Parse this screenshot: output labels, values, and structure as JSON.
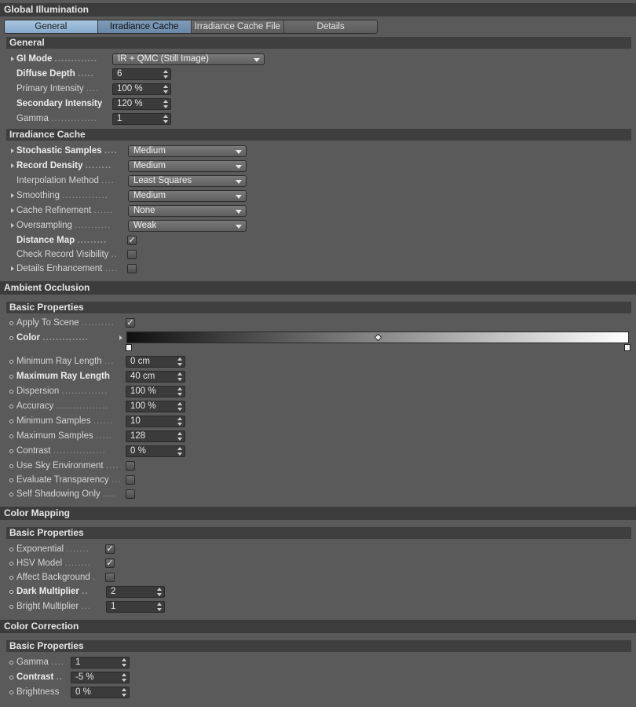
{
  "window_title": "Global Illumination",
  "tabs": [
    {
      "label": "General"
    },
    {
      "label": "Irradiance Cache"
    },
    {
      "label": "Irradiance Cache File"
    },
    {
      "label": "Details"
    }
  ],
  "general": {
    "title": "General",
    "gi_mode": {
      "label": "GI Mode",
      "value": "IR + QMC (Still Image)"
    },
    "diffuse_depth": {
      "label": "Diffuse Depth",
      "value": "6"
    },
    "primary_intensity": {
      "label": "Primary Intensity",
      "value": "100 %"
    },
    "secondary_intensity": {
      "label": "Secondary Intensity",
      "value": "120 %"
    },
    "gamma": {
      "label": "Gamma",
      "value": "1"
    }
  },
  "irradiance_cache": {
    "title": "Irradiance Cache",
    "stochastic_samples": {
      "label": "Stochastic Samples",
      "value": "Medium"
    },
    "record_density": {
      "label": "Record Density",
      "value": "Medium"
    },
    "interpolation_method": {
      "label": "Interpolation Method",
      "value": "Least Squares"
    },
    "smoothing": {
      "label": "Smoothing",
      "value": "Medium"
    },
    "cache_refinement": {
      "label": "Cache Refinement",
      "value": "None"
    },
    "oversampling": {
      "label": "Oversampling",
      "value": "Weak"
    },
    "distance_map": {
      "label": "Distance Map",
      "checked": true
    },
    "check_record_visibility": {
      "label": "Check Record Visibility",
      "checked": false
    },
    "details_enhancement": {
      "label": "Details Enhancement",
      "checked": false
    }
  },
  "ambient_occlusion": {
    "title": "Ambient Occlusion",
    "sub_title": "Basic Properties",
    "apply_to_scene": {
      "label": "Apply To Scene",
      "checked": true
    },
    "color": {
      "label": "Color"
    },
    "min_ray_length": {
      "label": "Minimum Ray Length",
      "value": "0 cm"
    },
    "max_ray_length": {
      "label": "Maximum Ray Length",
      "value": "40 cm"
    },
    "dispersion": {
      "label": "Dispersion",
      "value": "100 %"
    },
    "accuracy": {
      "label": "Accuracy",
      "value": "100 %"
    },
    "min_samples": {
      "label": "Minimum Samples",
      "value": "10"
    },
    "max_samples": {
      "label": "Maximum Samples",
      "value": "128"
    },
    "contrast": {
      "label": "Contrast",
      "value": "0 %"
    },
    "use_sky": {
      "label": "Use Sky Environment",
      "checked": false
    },
    "eval_transparency": {
      "label": "Evaluate Transparency",
      "checked": false
    },
    "self_shadowing": {
      "label": "Self Shadowing Only",
      "checked": false
    }
  },
  "color_mapping": {
    "title": "Color Mapping",
    "sub_title": "Basic Properties",
    "exponential": {
      "label": "Exponential",
      "checked": true
    },
    "hsv_model": {
      "label": "HSV Model",
      "checked": true
    },
    "affect_background": {
      "label": "Affect Background",
      "checked": false
    },
    "dark_multiplier": {
      "label": "Dark Multiplier",
      "value": "2"
    },
    "bright_multiplier": {
      "label": "Bright Multiplier",
      "value": "1"
    }
  },
  "color_correction": {
    "title": "Color Correction",
    "sub_title": "Basic Properties",
    "gamma": {
      "label": "Gamma",
      "value": "1"
    },
    "contrast": {
      "label": "Contrast",
      "value": "-5 %"
    },
    "brightness": {
      "label": "Brightness",
      "value": "0 %"
    }
  },
  "check_glyph": "✓"
}
